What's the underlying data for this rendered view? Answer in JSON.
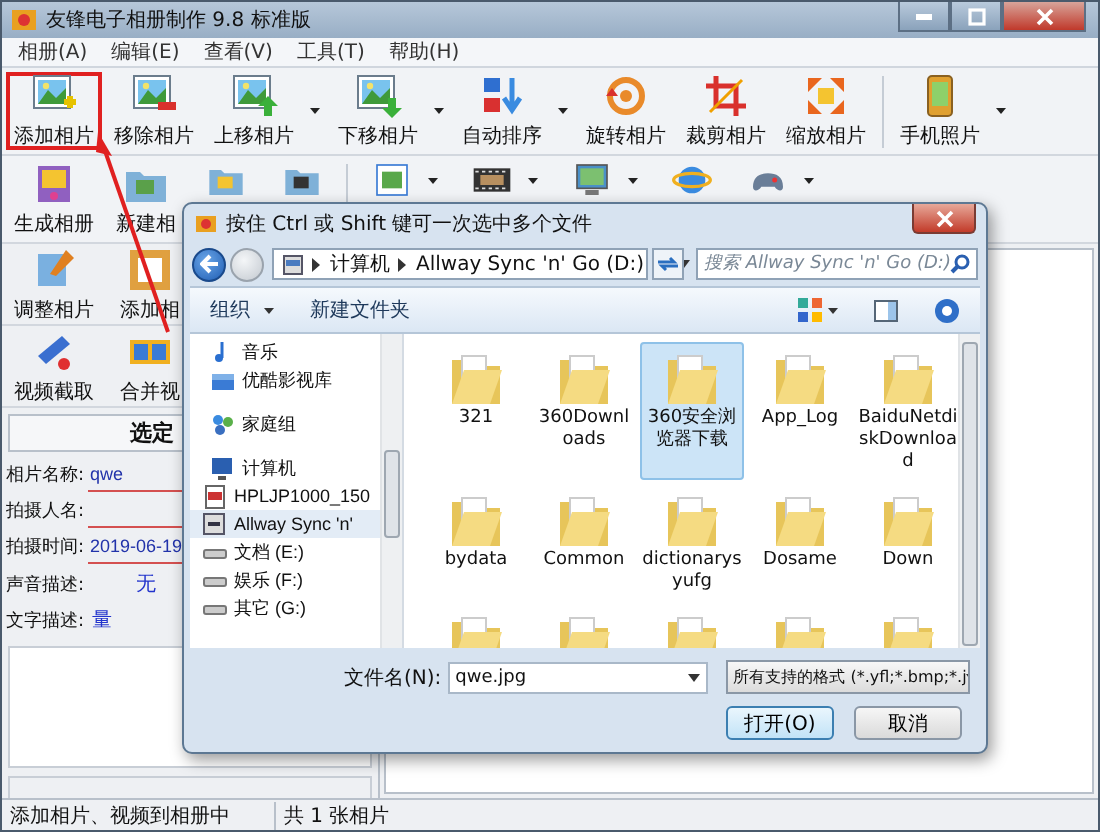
{
  "window": {
    "title": "友锋电子相册制作 9.8 标准版"
  },
  "menu": [
    {
      "label": "相册(A)"
    },
    {
      "label": "编辑(E)"
    },
    {
      "label": "查看(V)"
    },
    {
      "label": "工具(T)"
    },
    {
      "label": "帮助(H)"
    }
  ],
  "toolbar_rows": [
    [
      {
        "label": "添加相片",
        "dropdown": false,
        "highlighted": true
      },
      {
        "label": "移除相片",
        "dropdown": false,
        "highlighted": false
      },
      {
        "label": "上移相片",
        "dropdown": true,
        "highlighted": false
      },
      {
        "label": "下移相片",
        "dropdown": true,
        "highlighted": false
      },
      {
        "label": "自动排序",
        "dropdown": true,
        "highlighted": false
      },
      {
        "label": "旋转相片",
        "dropdown": false,
        "highlighted": false
      },
      {
        "label": "裁剪相片",
        "dropdown": false,
        "highlighted": false
      },
      {
        "label": "缩放相片",
        "dropdown": false,
        "highlighted": false
      },
      {
        "label": "手机照片",
        "dropdown": true,
        "highlighted": false
      }
    ],
    [
      {
        "label": "生成相册",
        "dropdown": false,
        "highlighted": false
      },
      {
        "label": "新建相",
        "dropdown": false,
        "highlighted": false
      },
      {
        "dropdown": false,
        "highlighted": false
      },
      {
        "dropdown": false,
        "highlighted": false
      },
      {
        "dropdown": true,
        "highlighted": false
      },
      {
        "dropdown": true,
        "highlighted": false
      },
      {
        "dropdown": true,
        "highlighted": false
      },
      {
        "dropdown": false,
        "highlighted": false
      },
      {
        "dropdown": true,
        "highlighted": false
      }
    ]
  ],
  "side_tools": [
    [
      {
        "label": "调整相片"
      },
      {
        "label": "添加相"
      }
    ],
    [
      {
        "label": "视频截取"
      },
      {
        "label": "合并视"
      }
    ]
  ],
  "panel": {
    "title": "选定",
    "fields": [
      {
        "kind": "input",
        "label": "相片名称:",
        "value": "qwe"
      },
      {
        "kind": "input",
        "label": "拍摄人名:"
      },
      {
        "kind": "input",
        "label": "拍摄时间:",
        "value": "2019-06-19"
      },
      {
        "kind": "text",
        "label": "声音描述:",
        "value": "无"
      },
      {
        "kind": "text",
        "label": "文字描述:",
        "value": "量"
      }
    ]
  },
  "status_bar": [
    "添加相片、视频到相册中",
    "共 1 张相片"
  ],
  "dialog": {
    "title": "按住 Ctrl 或 Shift 键可一次选中多个文件",
    "breadcrumb": [
      "计算机",
      "Allway Sync 'n' Go (D:)"
    ],
    "search": {
      "placeholder": "搜索 Allway Sync 'n' Go (D:)"
    },
    "toolbar": [
      {
        "label": "组织",
        "dropdown": true
      },
      {
        "label": "新建文件夹",
        "dropdown": false
      }
    ],
    "nav": [
      {
        "kind": "music",
        "label": "音乐",
        "selected": false
      },
      {
        "kind": "library",
        "label": "优酷影视库",
        "selected": false
      },
      {
        "kind": "homegroup",
        "label": "家庭组",
        "selected": false
      },
      {
        "kind": "computer",
        "label": "计算机",
        "selected": false,
        "children": [
          {
            "kind": "printer",
            "label": "HPLJP1000_150",
            "selected": false
          },
          {
            "kind": "disk",
            "label": "Allway Sync 'n'",
            "selected": true
          },
          {
            "kind": "drive",
            "label": "文档 (E:)",
            "selected": false
          },
          {
            "kind": "drive",
            "label": "娱乐 (F:)",
            "selected": false
          },
          {
            "kind": "drive",
            "label": "其它 (G:)",
            "selected": false
          }
        ]
      }
    ],
    "files": [
      {
        "name": "321",
        "selected": false
      },
      {
        "name": "360Downloads",
        "selected": false
      },
      {
        "name": "360安全浏览器下载",
        "selected": true
      },
      {
        "name": "App_Log",
        "selected": false
      },
      {
        "name": "BaiduNetdiskDownload",
        "selected": false
      },
      {
        "name": "bydata",
        "selected": false
      },
      {
        "name": "Common",
        "selected": false
      },
      {
        "name": "dictionarysyufg",
        "selected": false
      },
      {
        "name": "Dosame",
        "selected": false
      },
      {
        "name": "Down",
        "selected": false
      },
      {
        "selected": false
      },
      {
        "selected": false
      },
      {
        "selected": false
      },
      {
        "selected": false
      },
      {
        "selected": false
      }
    ],
    "filename_label": "文件名(N):",
    "filename": "qwe.jpg",
    "filter": "所有支持的格式 (*.yfl;*.bmp;*.j",
    "buttons": [
      {
        "label": "打开(O)",
        "default": true
      },
      {
        "label": "取消",
        "default": false
      }
    ]
  }
}
